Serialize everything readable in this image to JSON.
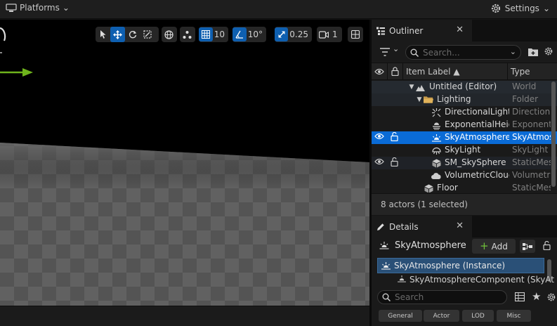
{
  "topbar": {
    "platforms_label": "Platforms",
    "settings_label": "Settings"
  },
  "viewport_toolbar": {
    "grid_snap_value": "10",
    "rotation_snap_value": "10°",
    "scale_snap_value": "0.25",
    "camera_speed_value": "1"
  },
  "outliner": {
    "tab_label": "Outliner",
    "search_placeholder": "Search...",
    "col_item_label": "Item Label ▲",
    "col_type": "Type",
    "rows": [
      {
        "name": "Untitled (Editor)",
        "type": "World",
        "icon": "world-icon"
      },
      {
        "name": "Lighting",
        "type": "Folder",
        "icon": "folder-icon"
      },
      {
        "name": "DirectionalLight",
        "type": "Directiona",
        "icon": "directional-light-icon"
      },
      {
        "name": "ExponentialHeig",
        "type": "Exponent",
        "icon": "fog-icon"
      },
      {
        "name": "SkyAtmosphere",
        "type": "SkyAtmos",
        "icon": "sky-atmosphere-icon"
      },
      {
        "name": "SkyLight",
        "type": "SkyLight",
        "icon": "sky-light-icon"
      },
      {
        "name": "SM_SkySphere",
        "type": "StaticMes",
        "icon": "static-mesh-icon"
      },
      {
        "name": "VolumetricClouc",
        "type": "Volumetri",
        "icon": "cloud-icon"
      },
      {
        "name": "Floor",
        "type": "StaticMes",
        "icon": "static-mesh-icon"
      }
    ],
    "status": "8 actors (1 selected)"
  },
  "details": {
    "tab_label": "Details",
    "actor_name": "SkyAtmosphere",
    "add_label": "Add",
    "instance_label": "SkyAtmosphere (Instance)",
    "component_label": "SkyAtmosphereComponent (SkyAt",
    "search_placeholder": "Search",
    "categories": [
      "General",
      "Actor",
      "LOD",
      "Misc"
    ]
  },
  "colors": {
    "accent": "#0a6bd6",
    "arrow": "#6fb41c",
    "panel": "#1a1a1a"
  }
}
